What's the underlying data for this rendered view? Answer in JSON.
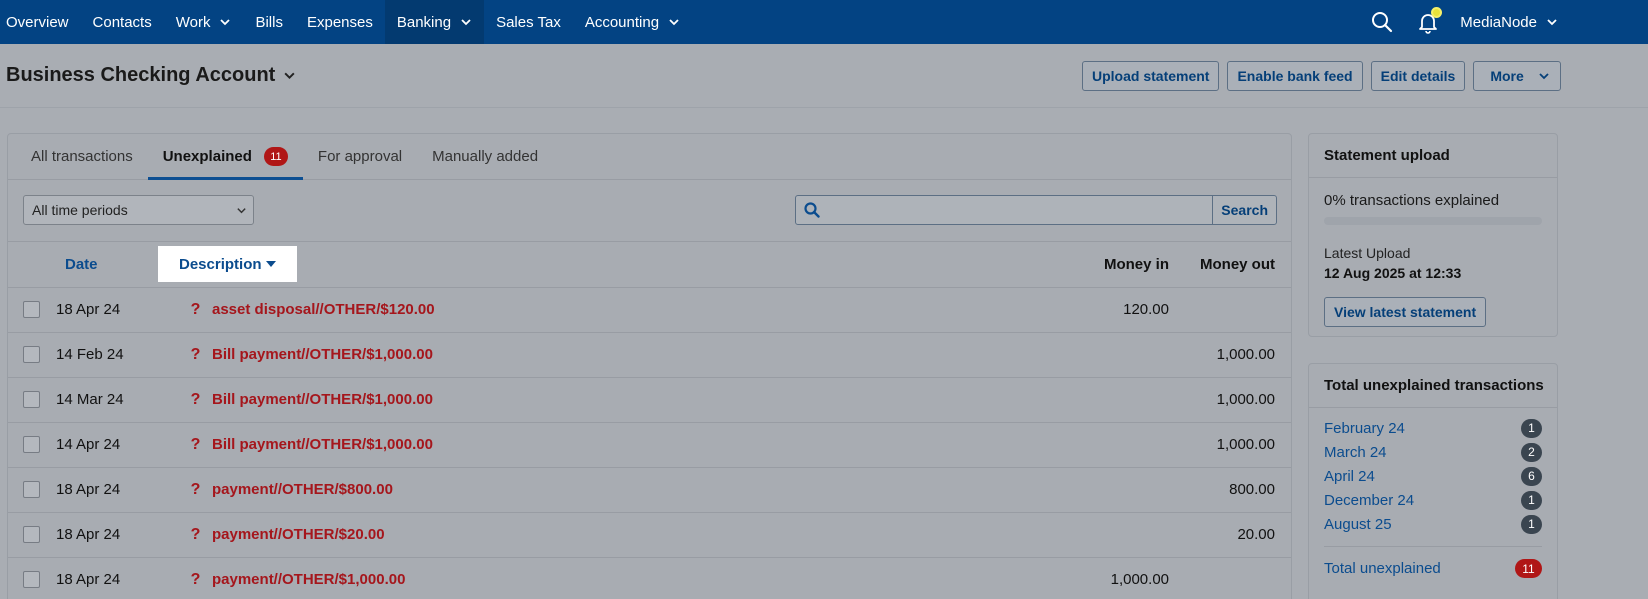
{
  "nav": {
    "items": [
      {
        "label": "Overview",
        "chevron": false,
        "active": false
      },
      {
        "label": "Contacts",
        "chevron": false,
        "active": false
      },
      {
        "label": "Work",
        "chevron": true,
        "active": false
      },
      {
        "label": "Bills",
        "chevron": false,
        "active": false
      },
      {
        "label": "Expenses",
        "chevron": false,
        "active": false
      },
      {
        "label": "Banking",
        "chevron": true,
        "active": true
      },
      {
        "label": "Sales Tax",
        "chevron": false,
        "active": false
      },
      {
        "label": "Accounting",
        "chevron": true,
        "active": false
      }
    ],
    "org_name": "MediaNode",
    "search_icon": "search-icon",
    "bell_icon": "bell-icon"
  },
  "page": {
    "title": "Business Checking Account",
    "buttons": {
      "upload": "Upload statement",
      "bank_feed": "Enable bank feed",
      "edit": "Edit details",
      "more": "More"
    }
  },
  "tabs": [
    {
      "label": "All transactions",
      "active": false
    },
    {
      "label": "Unexplained",
      "active": true,
      "badge": "11"
    },
    {
      "label": "For approval",
      "active": false
    },
    {
      "label": "Manually added",
      "active": false
    }
  ],
  "filters": {
    "period": "All time periods",
    "search_placeholder": "",
    "search_button": "Search"
  },
  "table": {
    "headers": {
      "date": "Date",
      "description": "Description",
      "money_in": "Money in",
      "money_out": "Money out"
    },
    "rows": [
      {
        "date": "18 Apr 24",
        "description": "asset disposal//OTHER/$120.00",
        "money_in": "120.00",
        "money_out": ""
      },
      {
        "date": "14 Feb 24",
        "description": "Bill payment//OTHER/$1,000.00",
        "money_in": "",
        "money_out": "1,000.00"
      },
      {
        "date": "14 Mar 24",
        "description": "Bill payment//OTHER/$1,000.00",
        "money_in": "",
        "money_out": "1,000.00"
      },
      {
        "date": "14 Apr 24",
        "description": "Bill payment//OTHER/$1,000.00",
        "money_in": "",
        "money_out": "1,000.00"
      },
      {
        "date": "18 Apr 24",
        "description": "payment//OTHER/$800.00",
        "money_in": "",
        "money_out": "800.00"
      },
      {
        "date": "18 Apr 24",
        "description": "payment//OTHER/$20.00",
        "money_in": "",
        "money_out": "20.00"
      },
      {
        "date": "18 Apr 24",
        "description": "payment//OTHER/$1,000.00",
        "money_in": "1,000.00",
        "money_out": ""
      }
    ],
    "row_status_icon": "?"
  },
  "statement_upload": {
    "title": "Statement upload",
    "explained_text": "0% transactions explained",
    "progress_fraction": 0,
    "latest_label": "Latest Upload",
    "latest_value": "12 Aug 2025 at 12:33",
    "view_button": "View latest statement"
  },
  "unexplained_summary": {
    "title": "Total unexplained transactions",
    "months": [
      {
        "label": "February 24",
        "count": "1"
      },
      {
        "label": "March 24",
        "count": "2"
      },
      {
        "label": "April 24",
        "count": "6"
      },
      {
        "label": "December 24",
        "count": "1"
      },
      {
        "label": "August 25",
        "count": "1"
      }
    ],
    "total_label": "Total unexplained",
    "total_count": "11"
  },
  "colors": {
    "nav_bg": "#034383",
    "accent": "#0b4c8e",
    "alert_red": "#a5161c"
  }
}
